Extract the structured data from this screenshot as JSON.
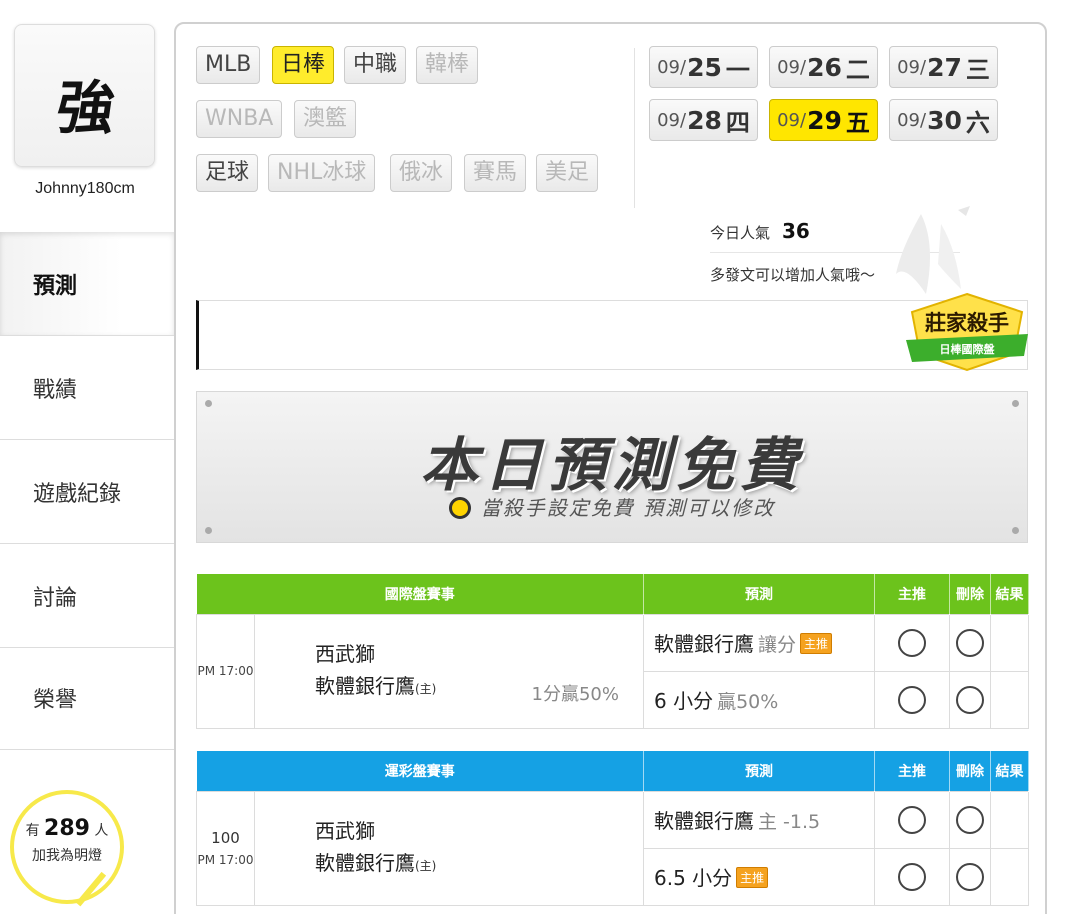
{
  "sidebar": {
    "avatar_glyph": "強",
    "username": "Johnny180cm",
    "nav": [
      "預測",
      "戰績",
      "遊戲紀錄",
      "討論",
      "榮譽"
    ],
    "fans": {
      "prefix": "有",
      "count": "289",
      "suffix": "人",
      "subtitle": "加我為明燈"
    }
  },
  "sport_tabs": [
    {
      "label": "MLB",
      "state": "normal"
    },
    {
      "label": "日棒",
      "state": "active"
    },
    {
      "label": "中職",
      "state": "normal"
    },
    {
      "label": "韓棒",
      "state": "disabled"
    },
    {
      "label": "WNBA",
      "state": "disabled"
    },
    {
      "label": "澳籃",
      "state": "disabled"
    },
    {
      "label": "足球",
      "state": "normal"
    },
    {
      "label": "NHL冰球",
      "state": "disabled"
    },
    {
      "label": "俄冰",
      "state": "disabled"
    },
    {
      "label": "賽馬",
      "state": "disabled"
    },
    {
      "label": "美足",
      "state": "disabled"
    }
  ],
  "dates": [
    {
      "month": "09/",
      "day": "25",
      "weekday": "一",
      "active": false
    },
    {
      "month": "09/",
      "day": "26",
      "weekday": "二",
      "active": false
    },
    {
      "month": "09/",
      "day": "27",
      "weekday": "三",
      "active": false
    },
    {
      "month": "09/",
      "day": "28",
      "weekday": "四",
      "active": false
    },
    {
      "month": "09/",
      "day": "29",
      "weekday": "五",
      "active": true
    },
    {
      "month": "09/",
      "day": "30",
      "weekday": "六",
      "active": false
    }
  ],
  "popularity": {
    "label": "今日人氣",
    "value": "36",
    "hint": "多發文可以增加人氣哦～"
  },
  "badge": {
    "title": "莊家殺手",
    "subtitle": "日棒國際盤"
  },
  "banner": {
    "title": "本日預測免費",
    "subtitle": "當殺手設定免費 預測可以修改"
  },
  "tables": [
    {
      "theme": "green",
      "headers": [
        "國際盤賽事",
        "預測",
        "主推",
        "刪除",
        "結果"
      ],
      "game_num": "",
      "time": "PM 17:00",
      "away": "西武獅",
      "home": "軟體銀行鷹",
      "home_mark": "(主)",
      "odds": "1分贏50%",
      "rows": [
        {
          "pick": "軟體銀行鷹",
          "extra": "讓分",
          "tag": "主推"
        },
        {
          "pick": "6 小分",
          "extra": "贏50%",
          "tag": ""
        }
      ]
    },
    {
      "theme": "blue",
      "headers": [
        "運彩盤賽事",
        "預測",
        "主推",
        "刪除",
        "結果"
      ],
      "game_num": "100",
      "time": "PM 17:00",
      "away": "西武獅",
      "home": "軟體銀行鷹",
      "home_mark": "(主)",
      "odds": "",
      "rows": [
        {
          "pick": "軟體銀行鷹",
          "extra": "主 -1.5",
          "tag": ""
        },
        {
          "pick": "6.5 小分",
          "extra": "",
          "tag": "主推"
        }
      ]
    }
  ]
}
